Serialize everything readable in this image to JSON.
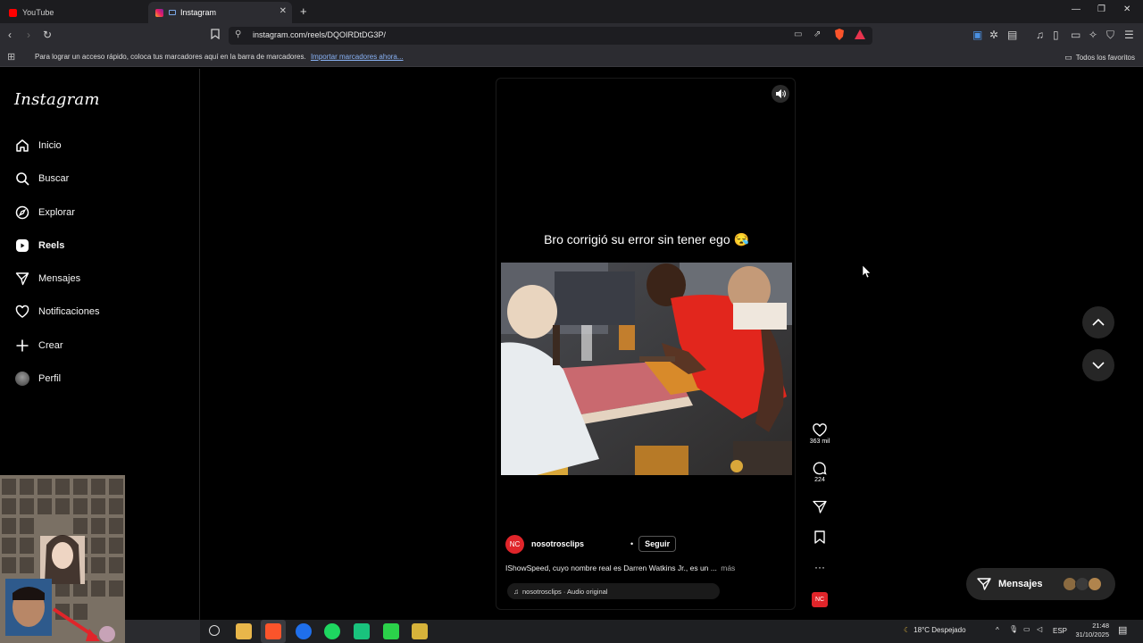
{
  "browser": {
    "tabs": [
      {
        "label": "YouTube"
      },
      {
        "label": "Instagram"
      }
    ],
    "url": "instagram.com/reels/DQOIRDtDG3P/",
    "bookmarks_bar": {
      "hint": "Para lograr un acceso rápido, coloca tus marcadores aquí en la barra de marcadores.",
      "import_link": "Importar marcadores ahora...",
      "all_favorites": "Todos los favoritos"
    }
  },
  "sidebar": {
    "logo": "Instagram",
    "items": [
      {
        "label": "Inicio",
        "icon": "home-icon"
      },
      {
        "label": "Buscar",
        "icon": "search-icon"
      },
      {
        "label": "Explorar",
        "icon": "compass-icon"
      },
      {
        "label": "Reels",
        "icon": "reels-icon"
      },
      {
        "label": "Mensajes",
        "icon": "send-icon"
      },
      {
        "label": "Notificaciones",
        "icon": "heart-icon"
      },
      {
        "label": "Crear",
        "icon": "plus-icon"
      },
      {
        "label": "Perfil",
        "icon": "avatar"
      }
    ]
  },
  "reel": {
    "caption_overlay": "Bro corrigió su error sin tener ego 😪",
    "author": {
      "initials": "NC",
      "username": "nosotrosclips"
    },
    "follow_label": "Seguir",
    "description": "IShowSpeed, cuyo nombre real es Darren Watkins Jr., es un ...",
    "more_label": "más",
    "audio": "nosotrosclips · Audio original",
    "likes": "363 mil",
    "comments": "224",
    "audio_avatar_initials": "NC"
  },
  "messages_pill": {
    "label": "Mensajes"
  },
  "taskbar": {
    "weather": "18°C  Despejado",
    "lang": "ESP",
    "time": "21:48",
    "date": "31/10/2025"
  },
  "colors": {
    "accent_red": "#e0252a",
    "brave_orange": "#fb542b"
  }
}
